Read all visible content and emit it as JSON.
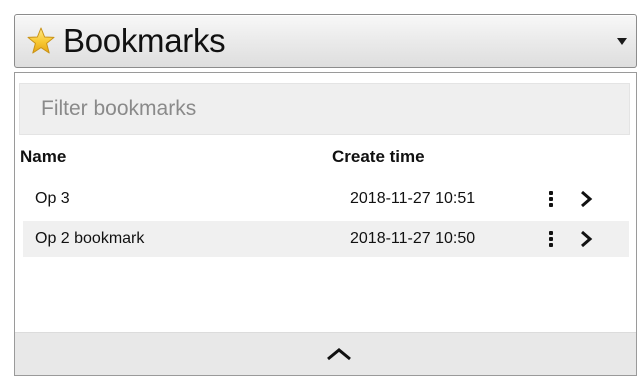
{
  "header": {
    "title": "Bookmarks",
    "star_icon": "star-icon",
    "dropdown_icon": "caret-down-icon",
    "star_color": "#f5c518"
  },
  "filter": {
    "placeholder": "Filter bookmarks"
  },
  "columns": {
    "name": "Name",
    "create_time": "Create time"
  },
  "bookmarks": [
    {
      "name": "Op 3",
      "create_time": "2018-11-27 10:51",
      "menu_icon": "vertical-dots-icon",
      "open_icon": "chevron-right-icon"
    },
    {
      "name": "Op 2 bookmark",
      "create_time": "2018-11-27 10:50",
      "menu_icon": "vertical-dots-icon",
      "open_icon": "chevron-right-icon"
    }
  ],
  "footer": {
    "collapse_icon": "chevron-up-icon"
  }
}
